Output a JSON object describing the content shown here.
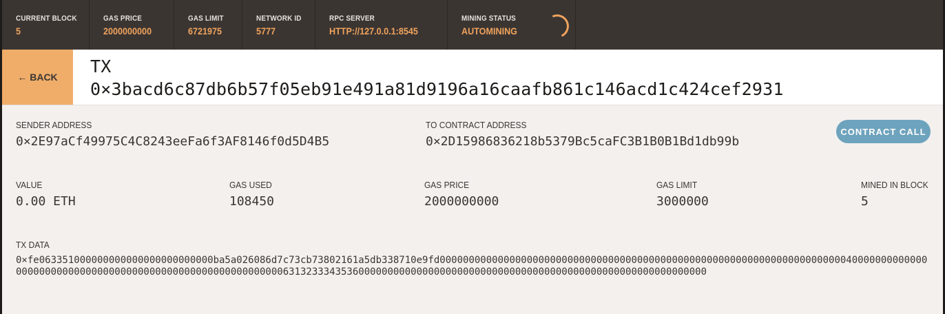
{
  "topbar": {
    "stats": [
      {
        "label": "CURRENT BLOCK",
        "value": "5"
      },
      {
        "label": "GAS PRICE",
        "value": "2000000000"
      },
      {
        "label": "GAS LIMIT",
        "value": "6721975"
      },
      {
        "label": "NETWORK ID",
        "value": "5777"
      },
      {
        "label": "RPC SERVER",
        "value": "HTTP://127.0.0.1:8545"
      },
      {
        "label": "MINING STATUS",
        "value": "AUTOMINING"
      }
    ]
  },
  "header": {
    "back_label": "← BACK",
    "title_prefix": "TX",
    "tx_hash": "0×3bacd6c87db6b57f05eb91e491a81d9196a16caafb861c146acd1c424cef2931"
  },
  "details": {
    "sender": {
      "label": "SENDER ADDRESS",
      "value": "0×2E97aCf49975C4C8243eeFa6f3AF8146f0d5D4B5"
    },
    "to_contract": {
      "label": "TO CONTRACT ADDRESS",
      "value": "0×2D15986836218b5379Bc5caFC3B1B0B1Bd1db99b"
    },
    "badge": "CONTRACT CALL",
    "value": {
      "label": "VALUE",
      "value": "0.00 ETH"
    },
    "gas_used": {
      "label": "GAS USED",
      "value": "108450"
    },
    "gas_price": {
      "label": "GAS PRICE",
      "value": "2000000000"
    },
    "gas_limit": {
      "label": "GAS LIMIT",
      "value": "3000000"
    },
    "mined_in_block": {
      "label": "MINED IN BLOCK",
      "value": "5"
    },
    "tx_data": {
      "label": "TX DATA",
      "value": "0×fe063351000000000000000000000000ba5a026086d7c73cb73802161a5db338710e9fd00000000000000000000000000000000000000000000000000000000000000000000004000000000000000000000000000000000000000000000000000000000006313233343536000000000000000000000000000000000000000000000000000000000000"
    }
  }
}
